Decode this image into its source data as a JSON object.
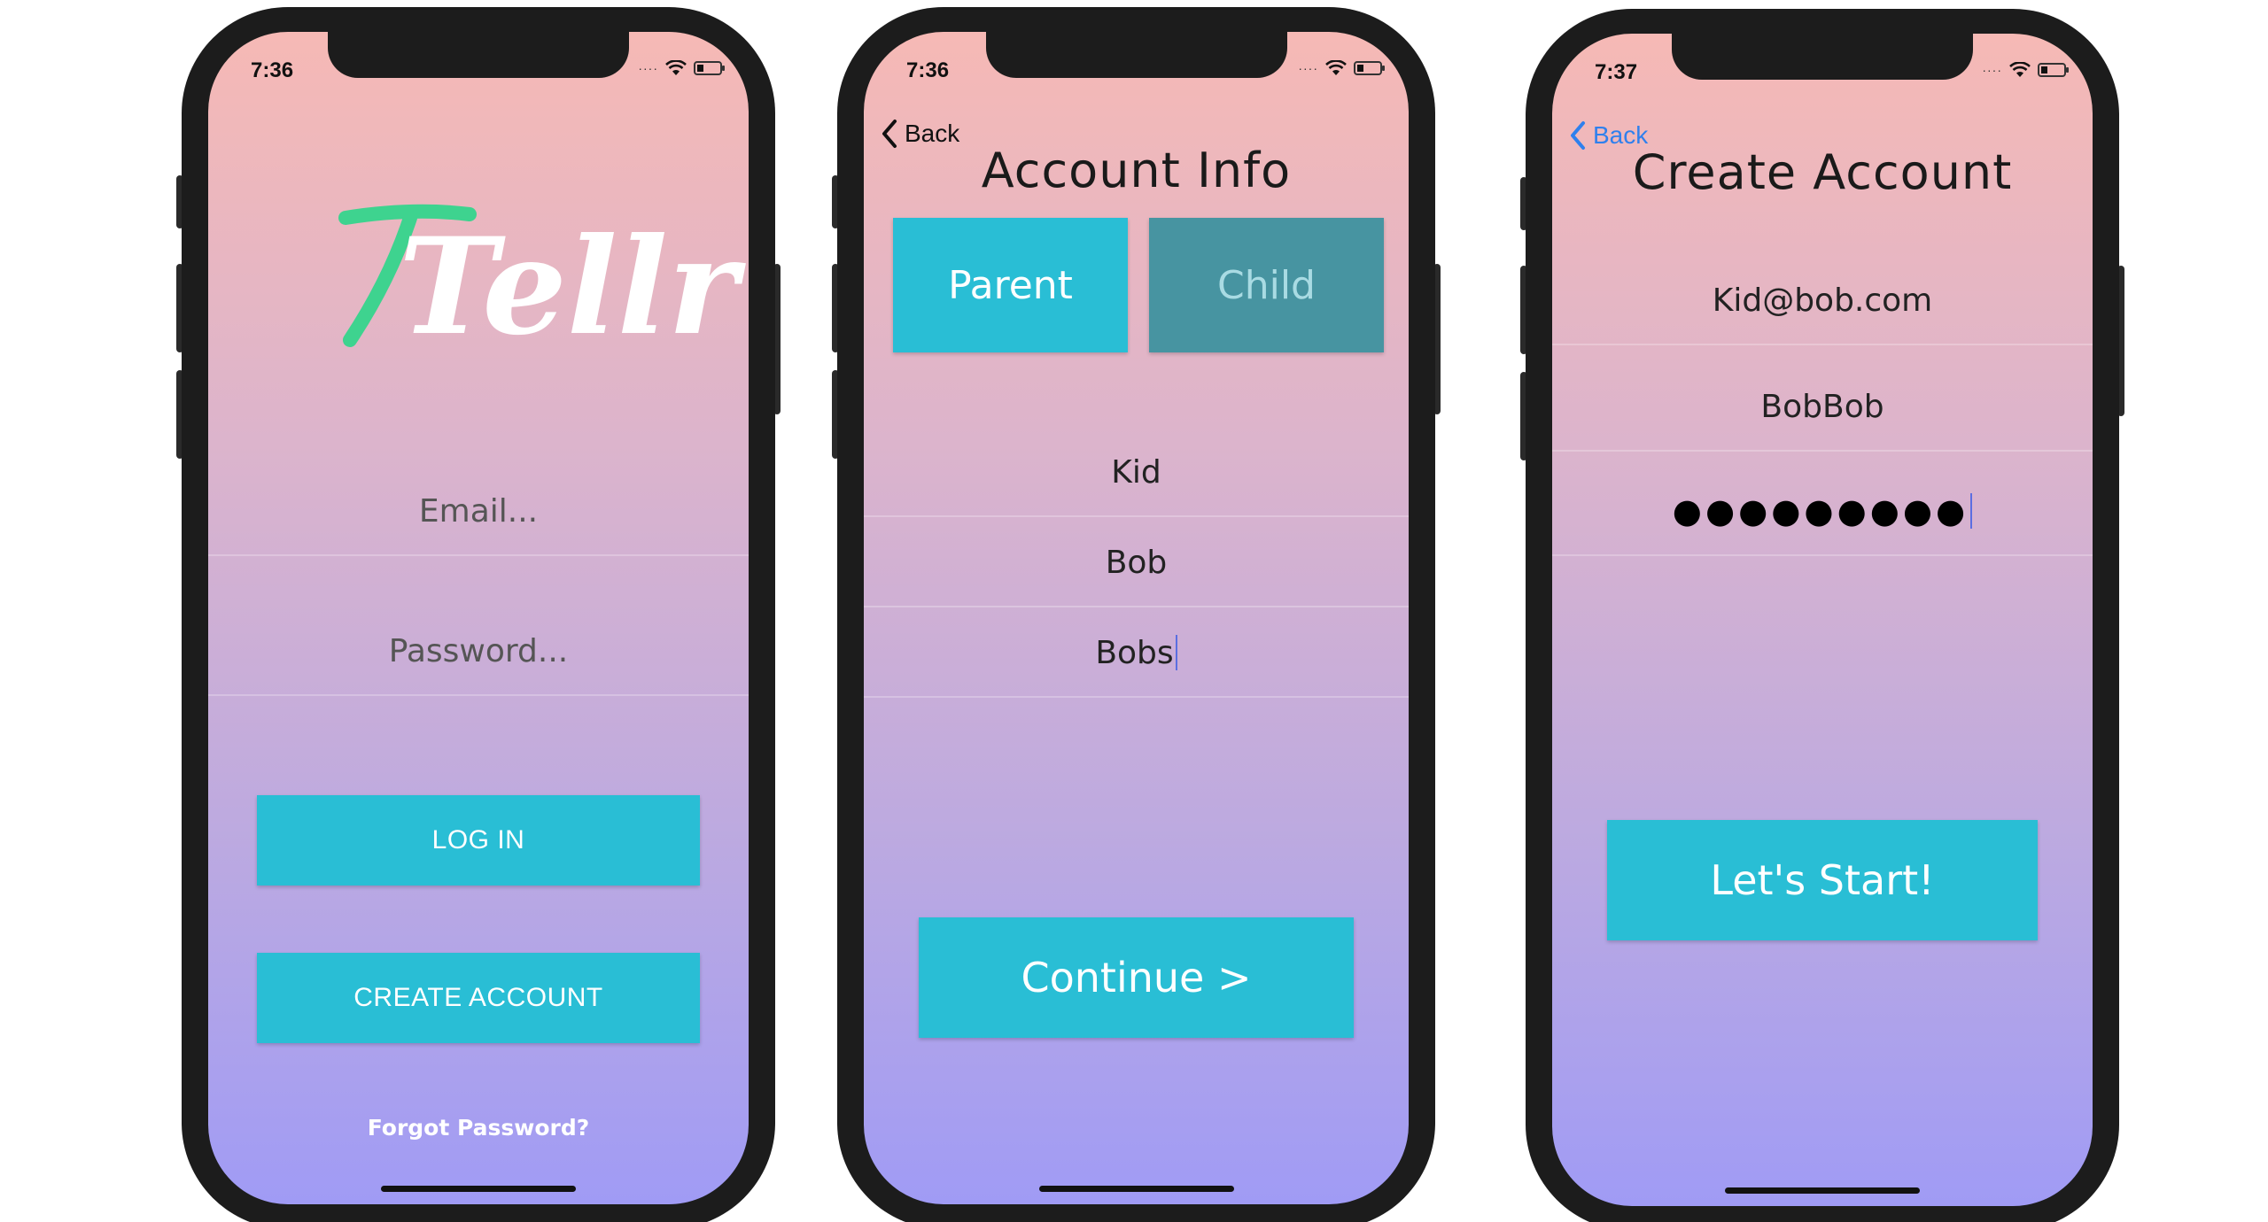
{
  "colors": {
    "accent": "#29bed5",
    "accent_dim": "#4794a1",
    "back_link": "#2f80ed"
  },
  "screen1": {
    "time": "7:36",
    "logo_text": "Tellr",
    "email_placeholder": "Email...",
    "password_placeholder": "Password...",
    "login_label": "LOG IN",
    "create_account_label": "CREATE ACCOUNT",
    "forgot_label": "Forgot Password?"
  },
  "screen2": {
    "time": "7:36",
    "back_label": "Back",
    "title": "Account Info",
    "segments": [
      "Parent",
      "Child"
    ],
    "selected_segment": "Parent",
    "fields": [
      "Kid",
      "Bob",
      "Bobs"
    ],
    "continue_label": "Continue >"
  },
  "screen3": {
    "time": "7:37",
    "back_label": "Back",
    "title": "Create Account",
    "email_value": "Kid@bob.com",
    "username_value": "BobBob",
    "password_mask": "●●●●●●●●●",
    "start_label": "Let's Start!"
  }
}
